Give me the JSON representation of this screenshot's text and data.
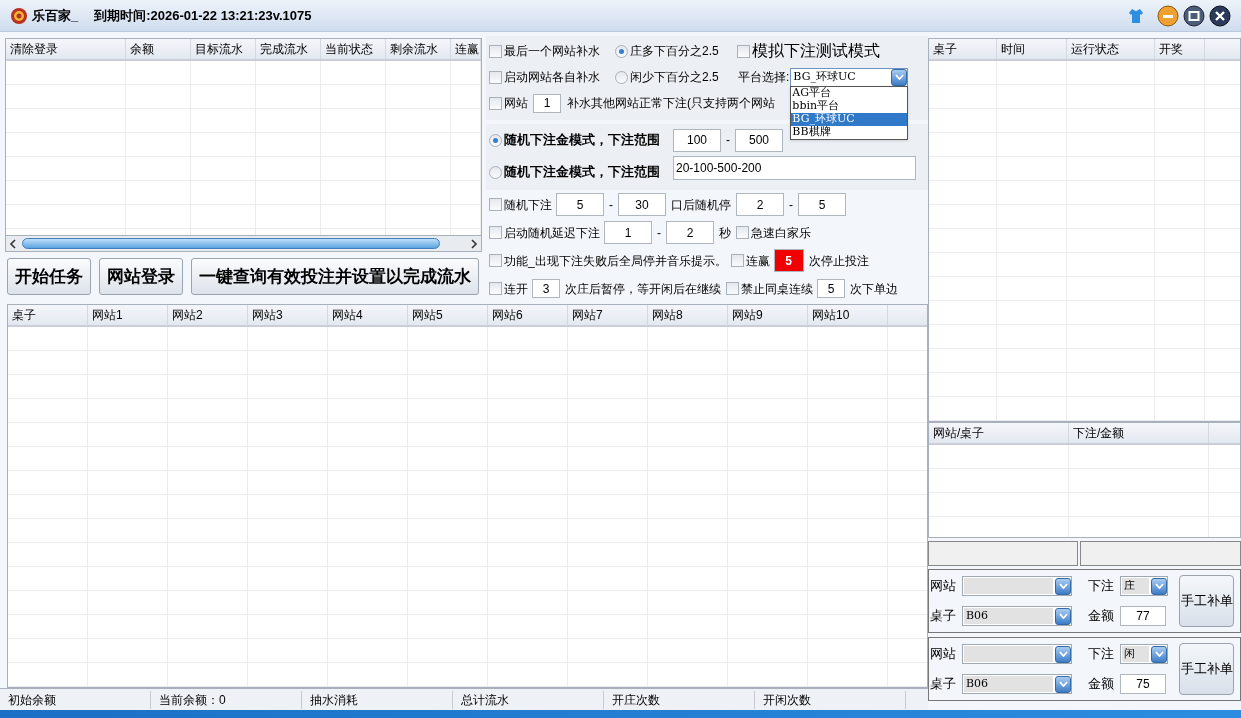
{
  "window": {
    "title": "乐百家_",
    "expiry": "到期时间:2026-01-22 13:21:23v.1075"
  },
  "accounts_table": {
    "columns": [
      "清除登录",
      "余额",
      "目标流水",
      "完成流水",
      "当前状态",
      "剩余流水",
      "连赢"
    ]
  },
  "actions": [
    "开始任务",
    "网站登录",
    "一键查询有效投注并设置以完成流水"
  ],
  "options": {
    "sections": [
      {
        "kind": "grid",
        "rows": [
          [
            {
              "kind": "checkbox",
              "label": "最后一个网站补水",
              "checked": false
            },
            {
              "kind": "radio",
              "label": "庄多下百分之2.5",
              "selected": true
            },
            {
              "kind": "checkbox_large",
              "label": "模拟下注测试模式",
              "checked": false
            }
          ],
          [
            {
              "kind": "checkbox",
              "label": "启动网站各自补水",
              "checked": false
            },
            {
              "kind": "radio",
              "label": "闲少下百分之2.5",
              "selected": false
            },
            {
              "kind": "label",
              "label": "平台选择:"
            },
            {
              "kind": "select",
              "value": "BG_环球UC",
              "expanded": true,
              "options": [
                {
                  "label": "AG平台",
                  "selected": false
                },
                {
                  "label": "bbin平台",
                  "selected": false
                },
                {
                  "label": "BG_环球UC",
                  "selected": true
                },
                {
                  "label": "BB棋牌",
                  "selected": false
                }
              ]
            }
          ]
        ]
      },
      {
        "kind": "flow_shaded",
        "rows": [
          [
            {
              "kind": "checkbox",
              "label": "网站",
              "checked": false
            },
            {
              "kind": "input_small",
              "value": "1"
            },
            {
              "kind": "label",
              "label": "补水其他网站正常下注(只支持两个网站"
            }
          ]
        ]
      },
      {
        "kind": "tall_shaded",
        "rows": [
          [
            {
              "kind": "radio_bold",
              "label": "随机下注金模式，下注范围",
              "selected": true
            },
            {
              "kind": "input",
              "value": "100"
            },
            {
              "kind": "label",
              "label": "-"
            },
            {
              "kind": "input",
              "value": "500"
            }
          ],
          [
            {
              "kind": "radio_bold",
              "label": "随机下注金模式，下注范围",
              "selected": false
            },
            {
              "kind": "input_wide",
              "value": "20-100-500-200"
            }
          ]
        ]
      },
      {
        "kind": "flow",
        "rows": [
          [
            {
              "kind": "checkbox",
              "label": "随机下注",
              "checked": false
            },
            {
              "kind": "input",
              "value": "5"
            },
            {
              "kind": "label",
              "label": "-"
            },
            {
              "kind": "input",
              "value": "30"
            },
            {
              "kind": "label",
              "label": "口后随机停"
            },
            {
              "kind": "input",
              "value": "2"
            },
            {
              "kind": "label",
              "label": "-"
            },
            {
              "kind": "input",
              "value": "5"
            }
          ]
        ]
      },
      {
        "kind": "flow",
        "rows": [
          [
            {
              "kind": "checkbox",
              "label": "启动随机延迟下注",
              "checked": false
            },
            {
              "kind": "input",
              "value": "1"
            },
            {
              "kind": "label",
              "label": "-"
            },
            {
              "kind": "input",
              "value": "2"
            },
            {
              "kind": "label",
              "label": "秒"
            },
            {
              "kind": "checkbox",
              "label": "急速白家乐",
              "checked": false
            }
          ]
        ]
      },
      {
        "kind": "flow",
        "rows": [
          [
            {
              "kind": "checkbox",
              "label": "功能_出现下注失败后全局停并音乐提示。",
              "checked": false
            },
            {
              "kind": "checkbox",
              "label": "连赢",
              "checked": false
            },
            {
              "kind": "input_alert",
              "value": "5"
            },
            {
              "kind": "label",
              "label": "次停止投注"
            }
          ]
        ]
      },
      {
        "kind": "flow",
        "rows": [
          [
            {
              "kind": "checkbox",
              "label": "连开",
              "checked": false
            },
            {
              "kind": "input_small",
              "value": "3"
            },
            {
              "kind": "label",
              "label": "次庄后暂停，等开闲后在继续"
            },
            {
              "kind": "checkbox",
              "label": "禁止同桌连续",
              "checked": false
            },
            {
              "kind": "input_small",
              "value": "5"
            },
            {
              "kind": "label",
              "label": "次下单边"
            }
          ]
        ]
      }
    ]
  },
  "results_table": {
    "columns": [
      "桌子",
      "网站1",
      "网站2",
      "网站3",
      "网站4",
      "网站5",
      "网站6",
      "网站7",
      "网站8",
      "网站9",
      "网站10"
    ]
  },
  "status_bar": [
    "初始余额",
    "当前余额：0",
    "抽水消耗",
    "总计流水",
    "开庄次数",
    "开闲次数"
  ],
  "tables_table": {
    "columns": [
      "桌子",
      "时间",
      "运行状态",
      "开奖"
    ]
  },
  "bets_table": {
    "columns": [
      "网站/桌子",
      "下注/金额"
    ]
  },
  "manual_orders": [
    {
      "site_label": "网站",
      "bet_label": "下注",
      "bet": "庄",
      "table_label": "桌子",
      "table": "B06",
      "amount_label": "金额",
      "amount": "77",
      "button": "手工补单"
    },
    {
      "site_label": "网站",
      "bet_label": "下注",
      "bet": "闲",
      "table_label": "桌子",
      "table": "B06",
      "amount_label": "金额",
      "amount": "75",
      "button": "手工补单"
    }
  ]
}
